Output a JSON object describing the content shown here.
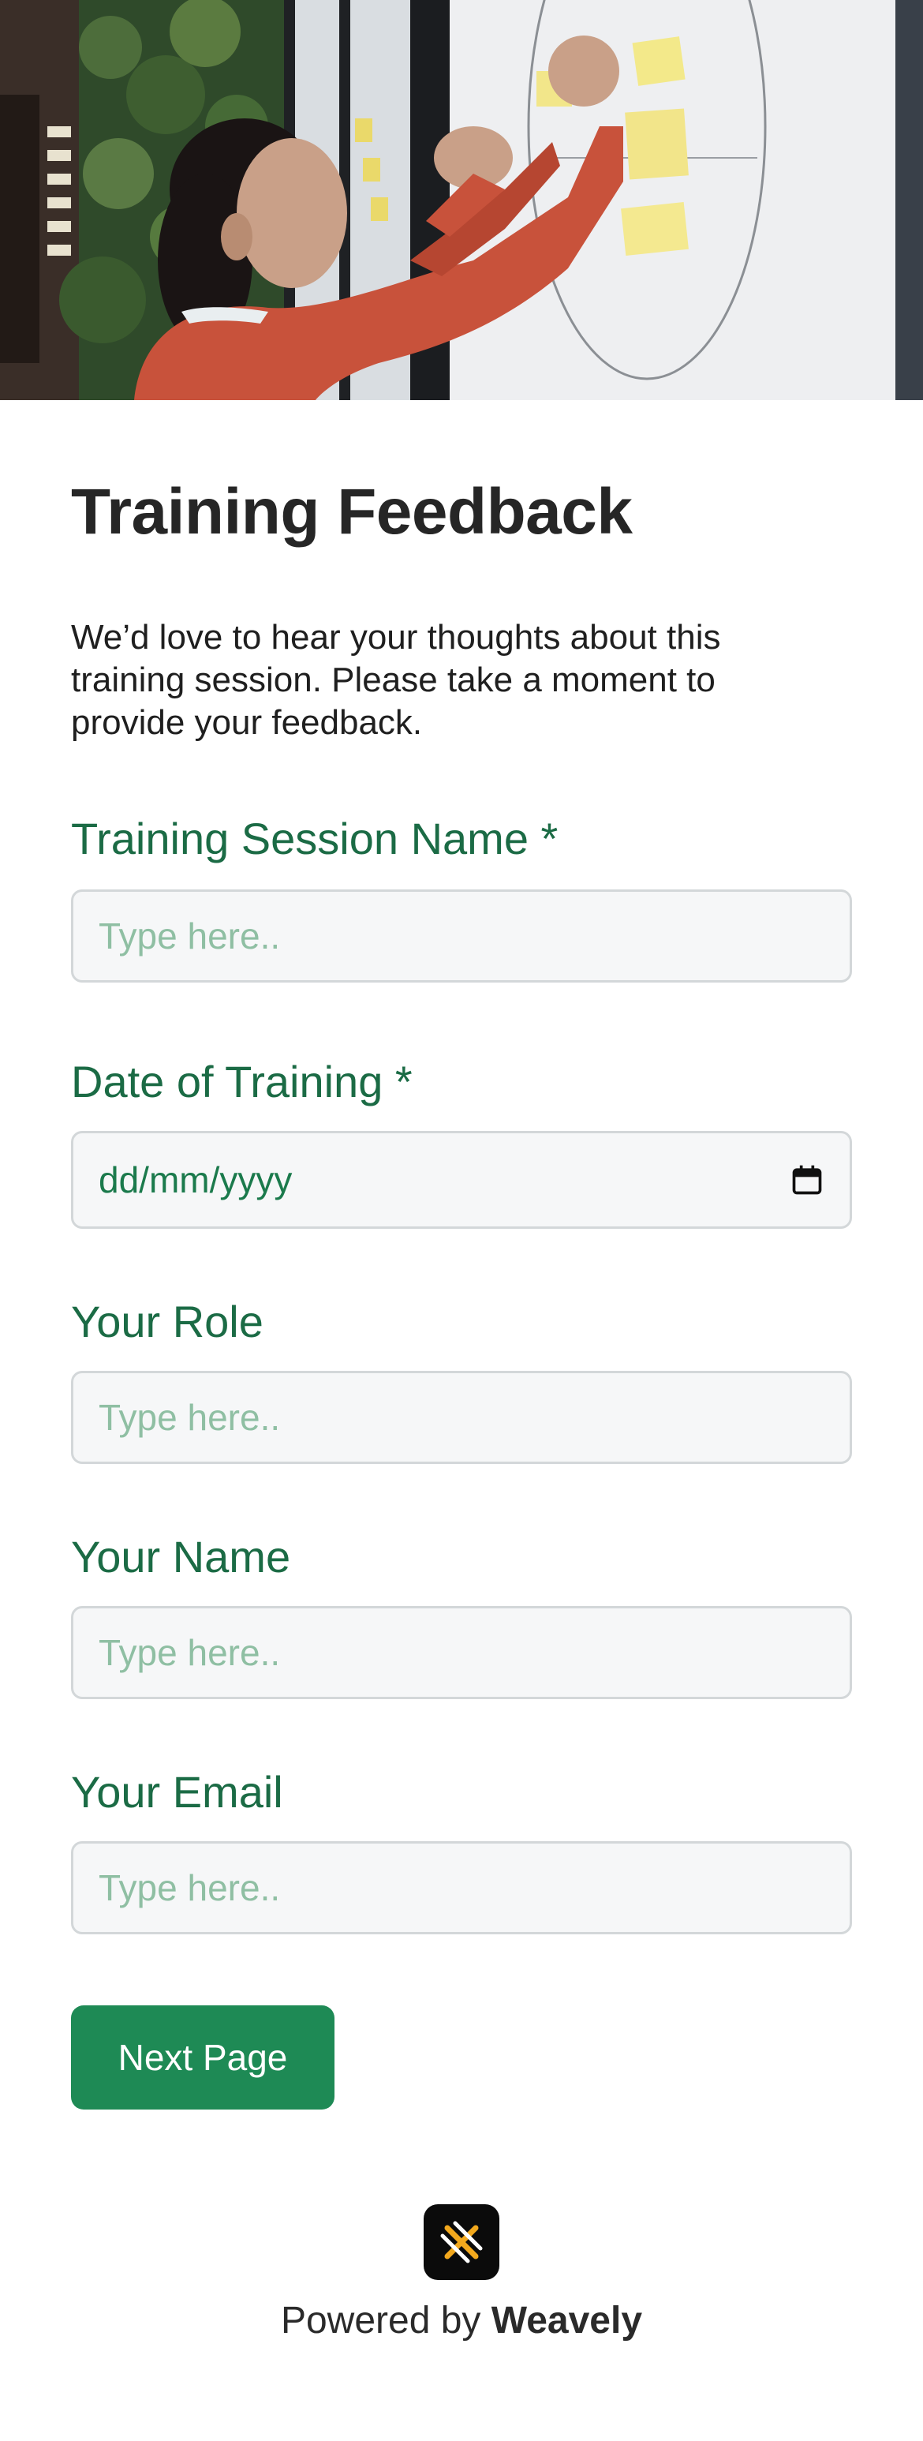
{
  "hero": {
    "alt": "Person placing sticky notes on a whiteboard"
  },
  "form": {
    "title": "Training Feedback",
    "description": "We’d love to hear your thoughts about this training session. Please take a moment to provide your feedback.",
    "fields": [
      {
        "label": "Training Session Name *",
        "placeholder": "Type here..",
        "value": ""
      },
      {
        "label": "Date of Training *",
        "placeholder": "dd/mm/yyyy",
        "value": ""
      },
      {
        "label": "Your Role",
        "placeholder": "Type here..",
        "value": ""
      },
      {
        "label": "Your Name",
        "placeholder": "Type here..",
        "value": ""
      },
      {
        "label": "Your Email",
        "placeholder": "Type here..",
        "value": ""
      }
    ],
    "next_button": "Next Page"
  },
  "footer": {
    "powered_prefix": "Powered by",
    "brand": "Weavely",
    "logo_icon": "weavely-logo-icon"
  },
  "colors": {
    "accent": "#1e8a55",
    "label": "#1b6b45",
    "placeholder": "#8fbfa3",
    "input_bg": "#f6f7f8"
  }
}
